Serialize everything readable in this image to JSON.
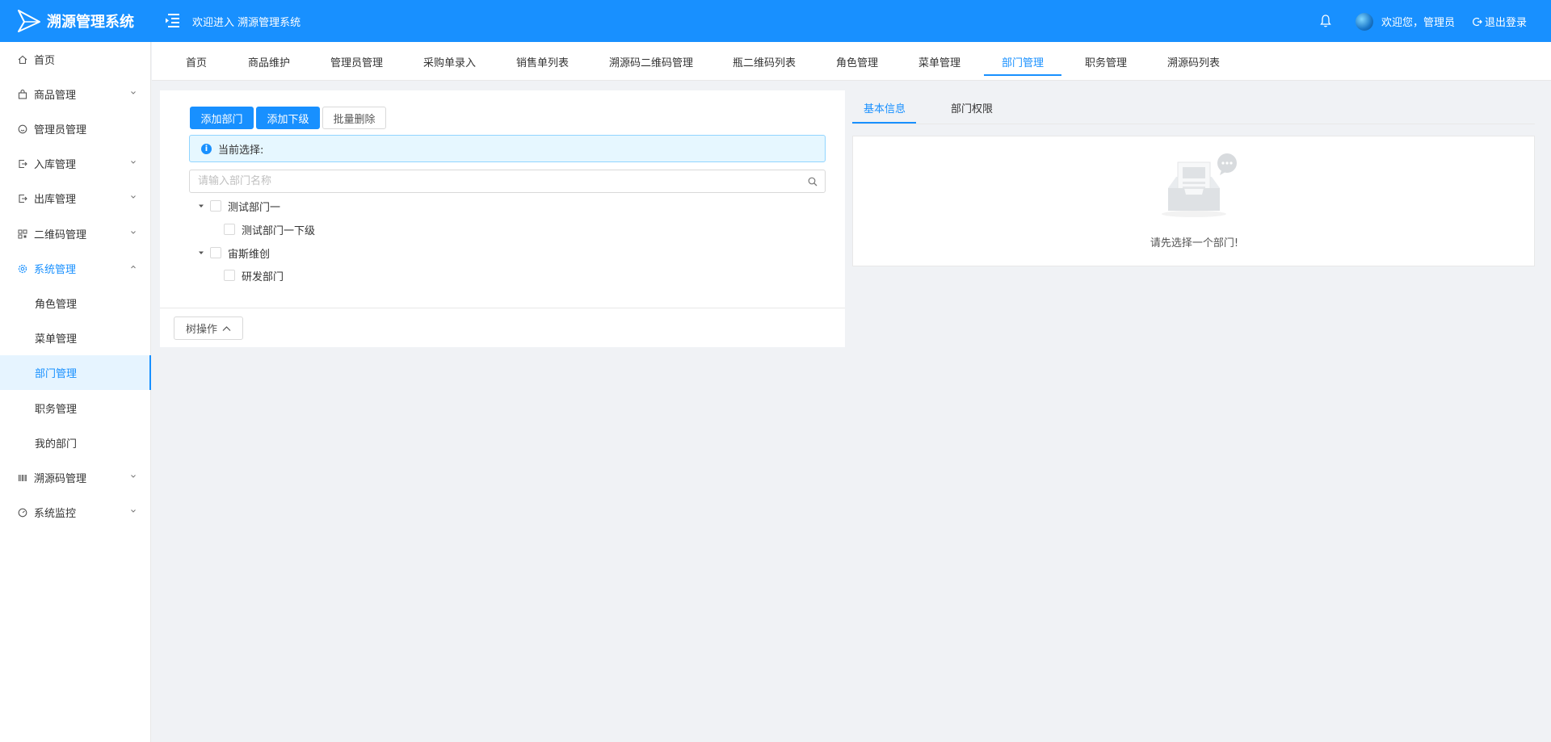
{
  "header": {
    "logo_text": "溯源管理系统",
    "welcome": "欢迎进入 溯源管理系统",
    "user_greeting": "欢迎您，管理员",
    "logout_label": "退出登录"
  },
  "sidebar": {
    "items": [
      {
        "label": "首页",
        "icon": "home-icon"
      },
      {
        "label": "商品管理",
        "icon": "shopping-bag-icon"
      },
      {
        "label": "管理员管理",
        "icon": "smile-icon"
      },
      {
        "label": "入库管理",
        "icon": "import-icon"
      },
      {
        "label": "出库管理",
        "icon": "export-icon"
      },
      {
        "label": "二维码管理",
        "icon": "qrcode-icon"
      },
      {
        "label": "系统管理",
        "icon": "setting-icon"
      },
      {
        "label": "溯源码管理",
        "icon": "barcode-icon"
      },
      {
        "label": "系统监控",
        "icon": "dashboard-icon"
      }
    ],
    "sub_items": [
      {
        "label": "角色管理"
      },
      {
        "label": "菜单管理"
      },
      {
        "label": "部门管理"
      },
      {
        "label": "职务管理"
      },
      {
        "label": "我的部门"
      }
    ]
  },
  "tabs": [
    {
      "label": "首页"
    },
    {
      "label": "商品维护"
    },
    {
      "label": "管理员管理"
    },
    {
      "label": "采购单录入"
    },
    {
      "label": "销售单列表"
    },
    {
      "label": "溯源码二维码管理"
    },
    {
      "label": "瓶二维码列表"
    },
    {
      "label": "角色管理"
    },
    {
      "label": "菜单管理"
    },
    {
      "label": "部门管理"
    },
    {
      "label": "职务管理"
    },
    {
      "label": "溯源码列表"
    }
  ],
  "dept": {
    "add_dept_label": "添加部门",
    "add_sub_label": "添加下级",
    "batch_delete_label": "批量删除",
    "current_selection": "当前选择:",
    "search_placeholder": "请输入部门名称",
    "tree": [
      {
        "label": "测试部门一"
      },
      {
        "label": "测试部门一下级"
      },
      {
        "label": "宙斯维创"
      },
      {
        "label": "研发部门"
      }
    ],
    "tree_ops_label": "树操作"
  },
  "right": {
    "tab_basic": "基本信息",
    "tab_perm": "部门权限",
    "empty_text": "请先选择一个部门!"
  },
  "colors": {
    "primary": "#1890ff",
    "background": "#f0f2f5"
  }
}
